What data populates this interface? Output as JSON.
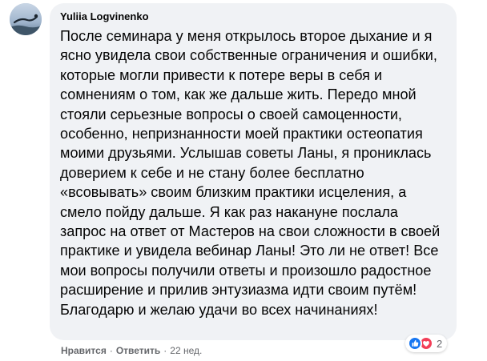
{
  "comment": {
    "author": "Yuliia Logvinenko",
    "text": "После семинара у меня открылось второе дыхание и я ясно увидела свои собственные ограничения и ошибки, которые могли привести к потере веры в себя и сомнениям о том, как же дальше жить. Передо мной стояли серьезные вопросы о своей самоценности, особенно, непризнанности моей практики остеопатия моими друзьями. Услышав советы Ланы, я прониклась доверием к себе и не стану более бесплатно «всовывать» своим близким практики исцеления, а смело пойду дальше. Я как раз накануне послала запрос на ответ от Мастеров на свои сложности в своей практике и увидела вебинар Ланы! Это ли не ответ! Все мои вопросы получили ответы и произошло радостное расширение и прилив энтузиазма идти своим путём! Благодарю и желаю удачи во всех начинаниях!"
  },
  "actions": {
    "like_label": "Нравится",
    "reply_label": "Ответить",
    "separator": "·",
    "timestamp": "22 нед."
  },
  "reactions": {
    "icons": [
      "like-icon",
      "love-icon"
    ],
    "count": "2",
    "colors": {
      "like": "#1877f2",
      "love": "#f33e58"
    }
  },
  "colors": {
    "bubble_background": "#f0f2f5",
    "text": "#050505",
    "secondary_text": "#65676b"
  }
}
